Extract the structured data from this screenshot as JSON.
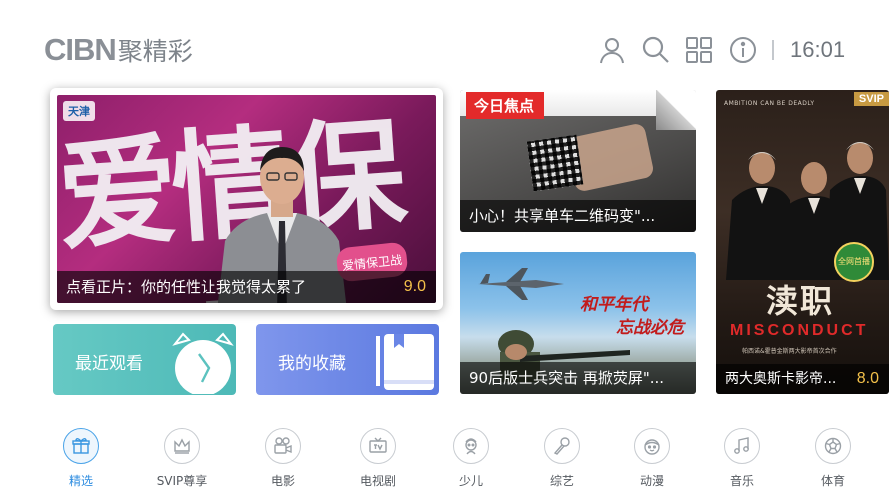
{
  "header": {
    "logo_en": "CIBN",
    "logo_cn": "聚精彩",
    "time": "16:01",
    "icons": [
      "user-icon",
      "search-icon",
      "grid-apps-icon",
      "info-icon"
    ]
  },
  "featured": {
    "station": "天津",
    "backdrop_text": "爱情保卫战",
    "heart_text": "爱情保卫战",
    "caption": "点看正片：你的任性让我觉得太累了",
    "score": "9.0"
  },
  "news_card": {
    "badge": "今日焦点",
    "caption": "小心！共享单车二维码变\"..."
  },
  "military_card": {
    "calligraphy_line1": "和平年代",
    "calligraphy_line2": "忘战必危",
    "caption": "90后版士兵突击 再掀荧屏\"..."
  },
  "poster_card": {
    "tagline": "AMBITION CAN BE DEADLY",
    "tag": "SVIP",
    "title_cn": "渎职",
    "title_en": "MISCONDUCT",
    "credits": "帕西诺&霍普金斯两大影帝首次合作",
    "seal": "全网首播",
    "caption": "两大奥斯卡影帝...",
    "score": "8.0"
  },
  "tiles": {
    "history_label": "最近观看",
    "favorites_label": "我的收藏"
  },
  "nav": [
    {
      "label": "精选",
      "icon": "gift-icon",
      "active": true
    },
    {
      "label": "SVIP尊享",
      "icon": "crown-icon",
      "active": false
    },
    {
      "label": "电影",
      "icon": "film-camera-icon",
      "active": false
    },
    {
      "label": "电视剧",
      "icon": "tv-icon",
      "active": false
    },
    {
      "label": "少儿",
      "icon": "child-icon",
      "active": false
    },
    {
      "label": "综艺",
      "icon": "microphone-icon",
      "active": false
    },
    {
      "label": "动漫",
      "icon": "anime-face-icon",
      "active": false
    },
    {
      "label": "音乐",
      "icon": "music-note-icon",
      "active": false
    },
    {
      "label": "体育",
      "icon": "soccer-ball-icon",
      "active": false
    }
  ],
  "colors": {
    "accent": "#3b97e0",
    "score": "#f3c04a",
    "history_tile": "#56bfbc",
    "favorites_tile": "#6a86e6"
  }
}
